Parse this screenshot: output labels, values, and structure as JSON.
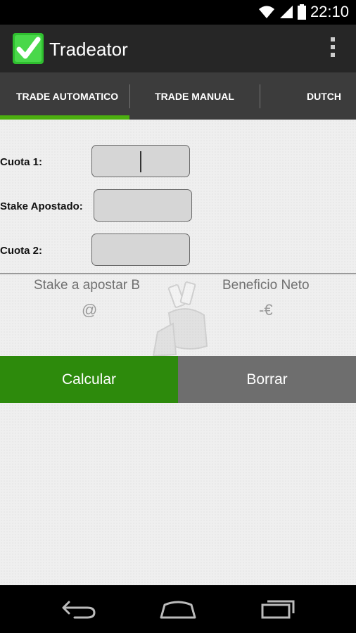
{
  "status_bar": {
    "time": "22:10",
    "icons": [
      "wifi-icon",
      "signal-icon",
      "battery-icon"
    ]
  },
  "app": {
    "title": "Tradeator",
    "icon": "checkmark-icon",
    "menu_icon": "overflow-menu-icon"
  },
  "tabs": [
    {
      "label": "TRADE AUTOMATICO",
      "selected": true
    },
    {
      "label": "TRADE MANUAL",
      "selected": false
    },
    {
      "label": "DUTCH",
      "selected": false
    }
  ],
  "form": {
    "cuota1_label": "Cuota 1:",
    "cuota1_value": "",
    "stake_label": "Stake Apostado:",
    "stake_value": "",
    "cuota2_label": "Cuota 2:",
    "cuota2_value": ""
  },
  "results": {
    "stake_label": "Stake a apostar B",
    "stake_value": "@",
    "profit_label": "Beneficio Neto",
    "profit_value": "-€"
  },
  "buttons": {
    "calcular": "Calcular",
    "borrar": "Borrar"
  },
  "nav": [
    "back-icon",
    "home-icon",
    "recent-apps-icon"
  ],
  "colors": {
    "accent": "#2d8a0c",
    "tab_indicator": "#4caf0f",
    "tab_bar": "#3c3c3c",
    "action_bar": "#262626",
    "secondary_button": "#6e6e6e"
  }
}
